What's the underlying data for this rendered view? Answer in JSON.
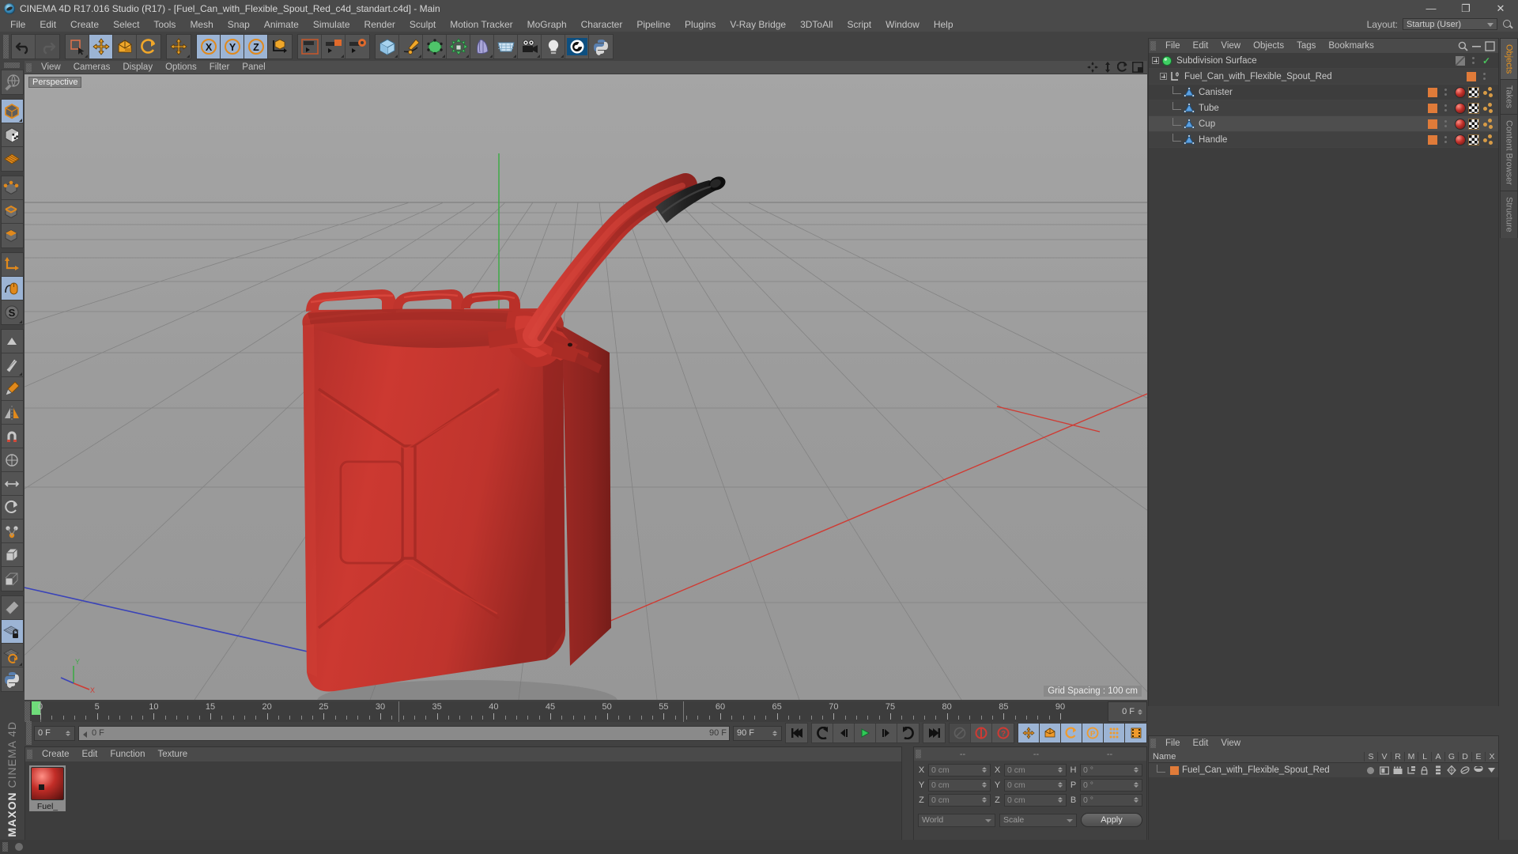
{
  "app": {
    "title": "CINEMA 4D R17.016 Studio (R17) - [Fuel_Can_with_Flexible_Spout_Red_c4d_standart.c4d] - Main",
    "brand_top": "MAXON",
    "brand_bottom": "CINEMA 4D"
  },
  "window_controls": {
    "minimize": "—",
    "maximize": "❐",
    "close": "✕"
  },
  "menubar": {
    "items": [
      "File",
      "Edit",
      "Create",
      "Select",
      "Tools",
      "Mesh",
      "Snap",
      "Animate",
      "Simulate",
      "Render",
      "Sculpt",
      "Motion Tracker",
      "MoGraph",
      "Character",
      "Pipeline",
      "Plugins",
      "V-Ray Bridge",
      "3DToAll",
      "Script",
      "Window",
      "Help"
    ],
    "layout_label": "Layout:",
    "layout_value": "Startup (User)"
  },
  "viewport": {
    "menus": [
      "View",
      "Cameras",
      "Display",
      "Options",
      "Filter",
      "Panel"
    ],
    "label": "Perspective",
    "grid_spacing": "Grid Spacing : 100 cm"
  },
  "object_manager": {
    "menus": [
      "File",
      "Edit",
      "View",
      "Objects",
      "Tags",
      "Bookmarks"
    ],
    "rows": [
      {
        "name": "Subdivision Surface",
        "depth": 0,
        "icon": "subdivision-surface-icon",
        "swatch": "grey",
        "check": true,
        "tags": false,
        "selected": false
      },
      {
        "name": "Fuel_Can_with_Flexible_Spout_Red",
        "depth": 1,
        "icon": "null-object-icon",
        "swatch": "orange",
        "check": false,
        "tags": false,
        "selected": false
      },
      {
        "name": "Canister",
        "depth": 2,
        "icon": "polygon-object-icon",
        "swatch": "orange",
        "check": false,
        "tags": true,
        "selected": false
      },
      {
        "name": "Tube",
        "depth": 2,
        "icon": "polygon-object-icon",
        "swatch": "orange",
        "check": false,
        "tags": true,
        "selected": false
      },
      {
        "name": "Cup",
        "depth": 2,
        "icon": "polygon-object-icon",
        "swatch": "orange",
        "check": false,
        "tags": true,
        "selected": true
      },
      {
        "name": "Handle",
        "depth": 2,
        "icon": "polygon-object-icon",
        "swatch": "orange",
        "check": false,
        "tags": true,
        "selected": false
      }
    ],
    "side_tabs": [
      "Objects",
      "Takes",
      "Content Browser",
      "Structure"
    ],
    "active_side_tab": "Objects"
  },
  "timeline": {
    "ticks": [
      0,
      5,
      10,
      15,
      20,
      25,
      30,
      35,
      40,
      45,
      50,
      55,
      60,
      65,
      70,
      75,
      80,
      85,
      90
    ],
    "min": 0,
    "max": 90,
    "current_frame": "0 F",
    "end_frame": "90 F",
    "slider_start": "0 F",
    "slider_end": "90 F",
    "preview_end": "90 F"
  },
  "material_manager": {
    "menus": [
      "Create",
      "Edit",
      "Function",
      "Texture"
    ],
    "materials": [
      {
        "name": "Fuel_"
      }
    ]
  },
  "coordinate_manager": {
    "headers": [
      "--",
      "--",
      "--"
    ],
    "position": {
      "label_x": "X",
      "label_y": "Y",
      "label_z": "Z",
      "x": "0 cm",
      "y": "0 cm",
      "z": "0 cm"
    },
    "size": {
      "label_x": "X",
      "label_y": "Y",
      "label_z": "Z",
      "x": "0 cm",
      "y": "0 cm",
      "z": "0 cm"
    },
    "rotation": {
      "label_h": "H",
      "label_p": "P",
      "label_b": "B",
      "h": "0 °",
      "p": "0 °",
      "b": "0 °"
    },
    "coord_system": "World",
    "mode": "Scale",
    "apply": "Apply"
  },
  "layer_manager": {
    "menus": [
      "File",
      "Edit",
      "View"
    ],
    "columns": [
      "S",
      "V",
      "R",
      "M",
      "L",
      "A",
      "G",
      "D",
      "E",
      "X"
    ],
    "name_header": "Name",
    "rows": [
      {
        "name": "Fuel_Can_with_Flexible_Spout_Red",
        "color": "#e07b39"
      }
    ]
  },
  "colors": {
    "accent_orange": "#e8941f",
    "material_red": "#c4302a",
    "model_red": "#c2302b",
    "selection_blue": "#9cb4d4",
    "check_green": "#49c25c",
    "playhead_green": "#6fdc7a",
    "panel_bg": "#414141",
    "viewport_bg": "#9a9a9a"
  }
}
